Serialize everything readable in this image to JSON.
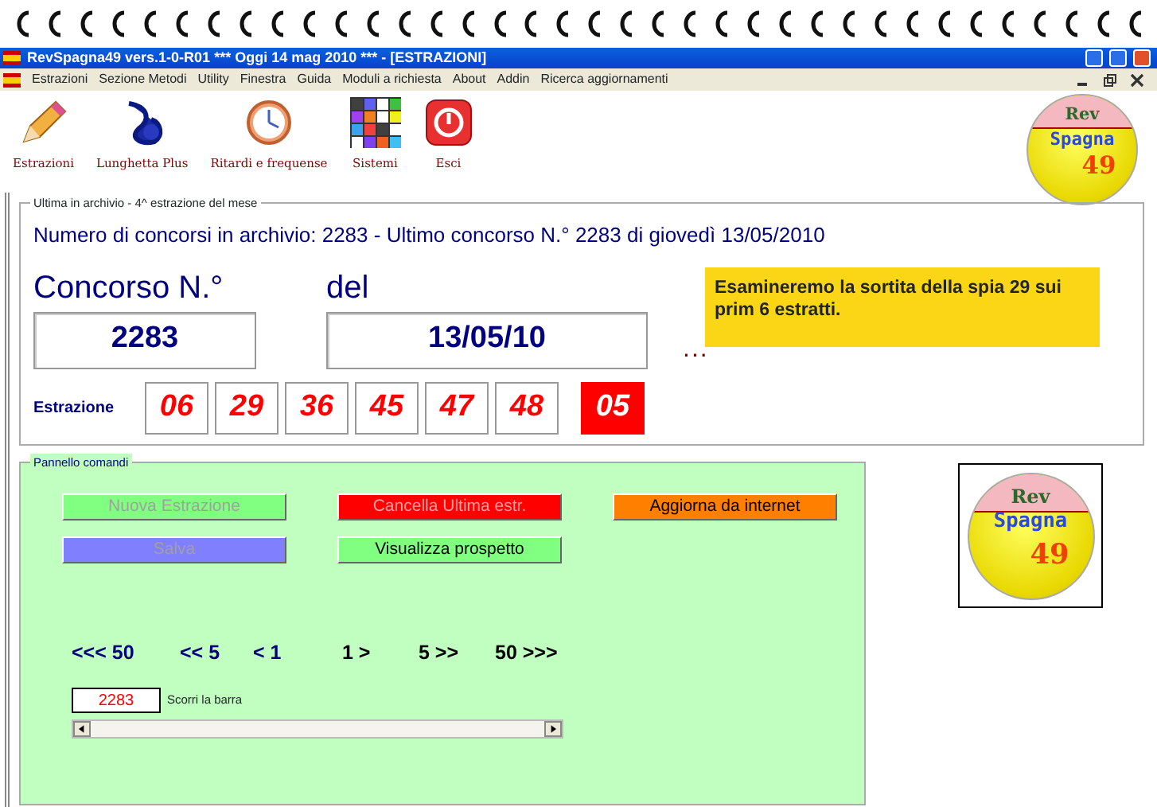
{
  "window": {
    "title": "RevSpagna49 vers.1-0-R01  ***  Oggi 14 mag 2010  ***   - [ESTRAZIONI]"
  },
  "menu": [
    "Estrazioni",
    "Sezione Metodi",
    "Utility",
    "Finestra",
    "Guida",
    "Moduli a richiesta",
    "About",
    "Addin",
    "Ricerca aggiornamenti"
  ],
  "toolbar": [
    {
      "kind": "pencil",
      "label": "Estrazioni"
    },
    {
      "kind": "lottery",
      "label": "Lunghetta Plus"
    },
    {
      "kind": "clock",
      "label": "Ritardi e frequense"
    },
    {
      "kind": "grid",
      "label": "Sistemi"
    },
    {
      "kind": "exit",
      "label": "Esci"
    }
  ],
  "logo": {
    "top": "Rev",
    "middle": "Spagna",
    "number": "49"
  },
  "archive": {
    "legend": "Ultima in archivio - 4^ estrazione del mese",
    "summary": "Numero di concorsi in archivio: 2283   -   Ultimo concorso N.° 2283 di giovedì 13/05/2010",
    "concorso_label": "Concorso N.°",
    "concorso_value": "2283",
    "date_label": "del",
    "date_value": "13/05/10",
    "dots": "...",
    "note": "Esamineremo la sortita della spia 29 sui prim 6 estratti.",
    "draw_label": "Estrazione",
    "numbers": [
      {
        "value": "06",
        "selected": false
      },
      {
        "value": "29",
        "selected": false
      },
      {
        "value": "36",
        "selected": false
      },
      {
        "value": "45",
        "selected": false
      },
      {
        "value": "47",
        "selected": false
      },
      {
        "value": "48",
        "selected": false
      },
      {
        "value": "05",
        "selected": true
      }
    ]
  },
  "panel": {
    "legend": "Pannello comandi",
    "buttons": [
      {
        "label": "Nuova Estrazione",
        "color": "#80ff80",
        "disabled": true
      },
      {
        "label": "Cancella Ultima estr.",
        "color": "#ff0000",
        "disabled": true
      },
      {
        "label": "Aggiorna da internet",
        "color": "#ff8000",
        "disabled": false
      },
      {
        "label": "Salva",
        "color": "#8080ff",
        "disabled": true
      },
      {
        "label": "Visualizza prospetto",
        "color": "#80ff80",
        "disabled": false
      }
    ],
    "nav": [
      {
        "label": "<<< 50",
        "disabled": false
      },
      {
        "label": "<< 5",
        "disabled": false
      },
      {
        "label": "< 1",
        "disabled": false
      },
      {
        "label": "1 >",
        "disabled": true
      },
      {
        "label": "5 >>",
        "disabled": true
      },
      {
        "label": "50 >>>",
        "disabled": true
      }
    ],
    "scroll_value": "2283",
    "scroll_label": "Scorri la barra"
  },
  "logo_box": {
    "top": "Rev",
    "middle": "Spagna",
    "number": "49"
  }
}
